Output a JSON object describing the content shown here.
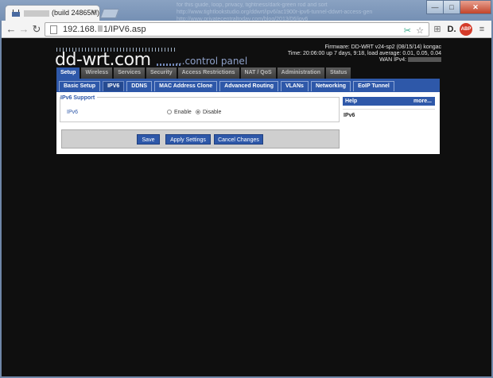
{
  "browser": {
    "tab_title": "(build 24865M)",
    "close_glyph": "×",
    "url": {
      "prefix": "192.168.",
      "suffix": "1/IPV6.asp"
    },
    "window_controls": [
      "—",
      "□",
      "✕"
    ],
    "background_text": [
      "for this guide, loop, privacy, tightness/dark-green rod and sort",
      "http://www.tightlookstudio.org/ddwrt/ipv6/ac1900r-ipv6-tunnel-ddwrt-access-gen",
      "http://www.privatecentraltoday.com/blog/2013/06/ipv6"
    ]
  },
  "header": {
    "logo": "dd-wrt.com",
    "logo_sub": "...control panel",
    "firmware": "Firmware: DD-WRT v24-sp2 (08/15/14) kongac",
    "time": "Time: 20:06:00 up 7 days, 9:18, load average: 0.01, 0.05, 0.04",
    "wan_label": "WAN IPv4:"
  },
  "menu": {
    "main": [
      "Setup",
      "Wireless",
      "Services",
      "Security",
      "Access Restrictions",
      "NAT / QoS",
      "Administration",
      "Status"
    ],
    "active_main": "Setup",
    "sub": [
      "Basic Setup",
      "IPV6",
      "DDNS",
      "MAC Address Clone",
      "Advanced Routing",
      "VLANs",
      "Networking",
      "EoIP Tunnel"
    ],
    "active_sub": "IPV6"
  },
  "content": {
    "section_title": "IPv6 Support",
    "field_label": "IPv6",
    "option_enable": "Enable",
    "option_disable": "Disable",
    "selected": "Disable",
    "buttons": {
      "save": "Save",
      "apply": "Apply Settings",
      "cancel": "Cancel Changes"
    }
  },
  "help": {
    "title": "Help",
    "more": "more...",
    "item": "IPv6"
  },
  "colors": {
    "accent": "#2e58a9",
    "background": "#0f0f0f"
  }
}
